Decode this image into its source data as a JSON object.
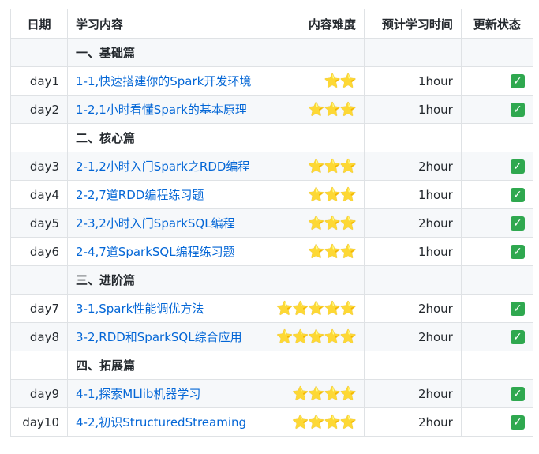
{
  "headers": {
    "day": "日期",
    "content": "学习内容",
    "difficulty": "内容难度",
    "time": "预计学习时间",
    "status": "更新状态"
  },
  "rows": [
    {
      "type": "section",
      "title": "一、基础篇"
    },
    {
      "type": "item",
      "day": "day1",
      "content": "1-1,快速搭建你的Spark开发环境",
      "difficulty": 2,
      "stars": "⭐⭐",
      "time": "1hour",
      "status": "done",
      "status_glyph": "✓"
    },
    {
      "type": "item",
      "day": "day2",
      "content": "1-2,1小时看懂Spark的基本原理",
      "difficulty": 3,
      "stars": "⭐⭐⭐",
      "time": "1hour",
      "status": "done",
      "status_glyph": "✓"
    },
    {
      "type": "section",
      "title": "二、核心篇"
    },
    {
      "type": "item",
      "day": "day3",
      "content": "2-1,2小时入门Spark之RDD编程",
      "difficulty": 3,
      "stars": "⭐⭐⭐",
      "time": "2hour",
      "status": "done",
      "status_glyph": "✓"
    },
    {
      "type": "item",
      "day": "day4",
      "content": "2-2,7道RDD编程练习题",
      "difficulty": 3,
      "stars": "⭐⭐⭐",
      "time": "1hour",
      "status": "done",
      "status_glyph": "✓"
    },
    {
      "type": "item",
      "day": "day5",
      "content": "2-3,2小时入门SparkSQL编程",
      "difficulty": 3,
      "stars": "⭐⭐⭐",
      "time": "2hour",
      "status": "done",
      "status_glyph": "✓"
    },
    {
      "type": "item",
      "day": "day6",
      "content": "2-4,7道SparkSQL编程练习题",
      "difficulty": 3,
      "stars": "⭐⭐⭐",
      "time": "1hour",
      "status": "done",
      "status_glyph": "✓"
    },
    {
      "type": "section",
      "title": "三、进阶篇"
    },
    {
      "type": "item",
      "day": "day7",
      "content": "3-1,Spark性能调优方法",
      "difficulty": 5,
      "stars": "⭐⭐⭐⭐⭐",
      "time": "2hour",
      "status": "done",
      "status_glyph": "✓"
    },
    {
      "type": "item",
      "day": "day8",
      "content": "3-2,RDD和SparkSQL综合应用",
      "difficulty": 5,
      "stars": "⭐⭐⭐⭐⭐",
      "time": "2hour",
      "status": "done",
      "status_glyph": "✓"
    },
    {
      "type": "section",
      "title": "四、拓展篇"
    },
    {
      "type": "item",
      "day": "day9",
      "content": "4-1,探索MLlib机器学习",
      "difficulty": 4,
      "stars": "⭐⭐⭐⭐",
      "time": "2hour",
      "status": "done",
      "status_glyph": "✓"
    },
    {
      "type": "item",
      "day": "day10",
      "content": "4-2,初识StructuredStreaming",
      "difficulty": 4,
      "stars": "⭐⭐⭐⭐",
      "time": "2hour",
      "status": "done",
      "status_glyph": "✓"
    }
  ],
  "colors": {
    "link": "#0366d6",
    "border": "#dfe2e5",
    "stripe": "#f6f8fa",
    "check_bg": "#2fa84f",
    "star": "#f5c518"
  },
  "icons": {
    "difficulty": "star-icon",
    "status_done": "check-mark-button-icon"
  }
}
